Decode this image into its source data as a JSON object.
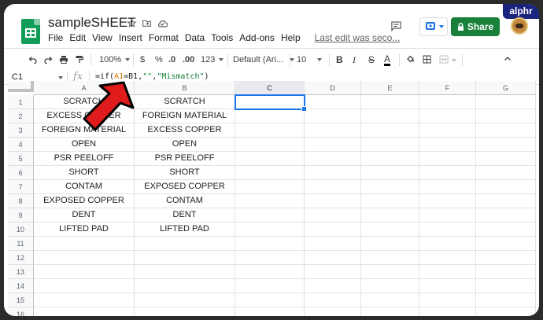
{
  "app": {
    "title": "sampleSHEET",
    "last_edit": "Last edit was seco...",
    "share_label": "Share",
    "brand_badge": "alphr"
  },
  "menu": [
    "File",
    "Edit",
    "View",
    "Insert",
    "Format",
    "Data",
    "Tools",
    "Add-ons",
    "Help"
  ],
  "toolbar": {
    "zoom": "100%",
    "currency": "$",
    "percent": "%",
    "decrease_decimal": ".0",
    "increase_decimal": ".00",
    "more_formats": "123",
    "font": "Default (Ari...",
    "font_size": "10",
    "bold": "B",
    "italic": "I",
    "strike": "S",
    "text_color": "A"
  },
  "formula_bar": {
    "cell_ref": "C1",
    "fx": "fx",
    "formula_parts": [
      "=if(",
      "A1",
      "=B1,",
      "\"\"",
      ",",
      "\"Mismatch\"",
      ")"
    ]
  },
  "columns": [
    "A",
    "B",
    "C",
    "D",
    "E",
    "F",
    "G"
  ],
  "rows": [
    {
      "num": "1",
      "a": "SCRATCH",
      "b": "SCRATCH"
    },
    {
      "num": "2",
      "a": "EXCESS COPPER",
      "b": "FOREIGN MATERIAL"
    },
    {
      "num": "3",
      "a": "FOREIGN MATERIAL",
      "b": "EXCESS COPPER"
    },
    {
      "num": "4",
      "a": "OPEN",
      "b": "OPEN"
    },
    {
      "num": "5",
      "a": "PSR PEELOFF",
      "b": "PSR PEELOFF"
    },
    {
      "num": "6",
      "a": "SHORT",
      "b": "SHORT"
    },
    {
      "num": "7",
      "a": "CONTAM",
      "b": "EXPOSED COPPER"
    },
    {
      "num": "8",
      "a": "EXPOSED COPPER",
      "b": "CONTAM"
    },
    {
      "num": "9",
      "a": "DENT",
      "b": "DENT"
    },
    {
      "num": "10",
      "a": "LIFTED PAD",
      "b": "LIFTED PAD"
    },
    {
      "num": "11",
      "a": "",
      "b": ""
    },
    {
      "num": "12",
      "a": "",
      "b": ""
    },
    {
      "num": "13",
      "a": "",
      "b": ""
    },
    {
      "num": "14",
      "a": "",
      "b": ""
    },
    {
      "num": "15",
      "a": "",
      "b": ""
    },
    {
      "num": "16",
      "a": "",
      "b": ""
    }
  ],
  "selected_cell": "C1",
  "colors": {
    "sheets_green": "#0f9d58",
    "share_green": "#188038",
    "selection_blue": "#1a73e8",
    "arrow_red": "#e01b1b",
    "ref_orange": "#e37400",
    "string_green": "#188038"
  }
}
